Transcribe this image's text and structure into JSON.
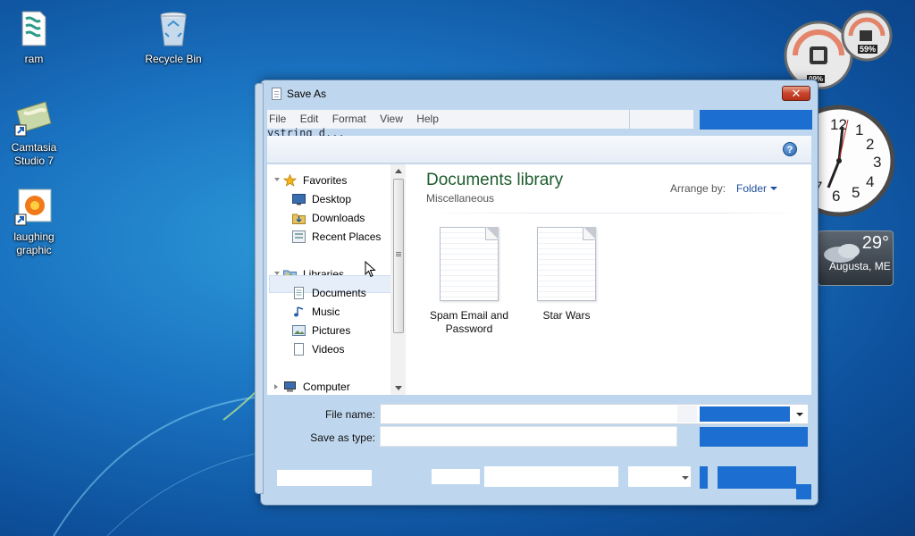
{
  "desktop": {
    "icons": [
      {
        "label": "ram"
      },
      {
        "label": "Recycle Bin"
      },
      {
        "label": "Camtasia Studio 7"
      },
      {
        "label": "laughing graphic"
      }
    ]
  },
  "gadgets": {
    "cpu_meter": {
      "cpu_percent": "09%",
      "memory_percent": "59%"
    },
    "clock": {
      "numbers": [
        "12",
        "1",
        "2",
        "3",
        "4",
        "5",
        "6",
        "7"
      ]
    },
    "weather": {
      "temperature": "29°",
      "location": "Augusta, ME"
    }
  },
  "window": {
    "title": "Save As",
    "close_glyph": "✕",
    "menu": [
      "File",
      "Edit",
      "Format",
      "View",
      "Help"
    ],
    "garbled_text": "ystring d...",
    "help_glyph": "?",
    "nav": {
      "favorites": {
        "label": "Favorites",
        "items": [
          "Desktop",
          "Downloads",
          "Recent Places"
        ]
      },
      "libraries": {
        "label": "Libraries",
        "items": [
          "Documents",
          "Music",
          "Pictures",
          "Videos"
        ]
      },
      "computer": {
        "label": "Computer"
      },
      "selected": "Documents"
    },
    "content": {
      "title": "Documents library",
      "subtitle": "Miscellaneous",
      "arrange_label": "Arrange by:",
      "arrange_value": "Folder",
      "files": [
        {
          "name": "Spam Email and Password"
        },
        {
          "name": "Star Wars"
        }
      ]
    },
    "form": {
      "file_name_label": "File name:",
      "file_name_value": "",
      "save_as_type_label": "Save as type:",
      "save_as_type_value": ""
    },
    "colors": {
      "accent_blue": "#1c6fd0",
      "library_title": "#1e5d2e"
    }
  }
}
